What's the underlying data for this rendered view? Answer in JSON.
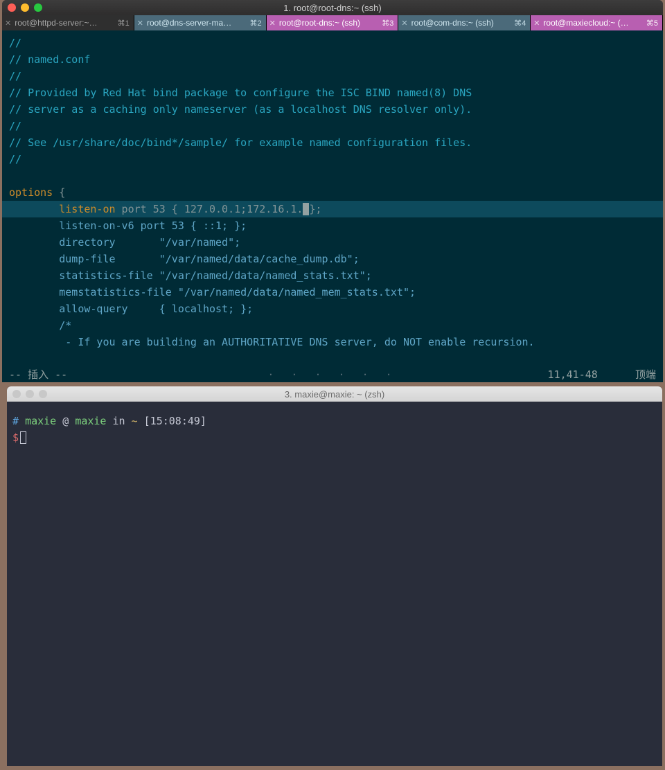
{
  "topWindow": {
    "title": "1. root@root-dns:~ (ssh)",
    "tabs": [
      {
        "label": "root@httpd-server:~…",
        "shortcut": "⌘1",
        "state": "normal"
      },
      {
        "label": "root@dns-server-ma…",
        "shortcut": "⌘2",
        "state": "dim"
      },
      {
        "label": "root@root-dns:~ (ssh)",
        "shortcut": "⌘3",
        "state": "active"
      },
      {
        "label": "root@com-dns:~ (ssh)",
        "shortcut": "⌘4",
        "state": "dim"
      },
      {
        "label": "root@maxiecloud:~ (…",
        "shortcut": "⌘5",
        "state": "active"
      }
    ],
    "editor": {
      "comments": [
        "//",
        "// named.conf",
        "//",
        "// Provided by Red Hat bind package to configure the ISC BIND named(8) DNS",
        "// server as a caching only nameserver (as a localhost DNS resolver only).",
        "//",
        "// See /usr/share/doc/bind*/sample/ for example named configuration files.",
        "//"
      ],
      "options_kw": "options",
      "brace_open": " {",
      "listen_on": {
        "key": "listen-on",
        "rest": " port 53 { 127.0.0.1;172.16.1.",
        "tail": "};"
      },
      "body": [
        "        listen-on-v6 port 53 { ::1; };",
        "        directory       \"/var/named\";",
        "        dump-file       \"/var/named/data/cache_dump.db\";",
        "        statistics-file \"/var/named/data/named_stats.txt\";",
        "        memstatistics-file \"/var/named/data/named_mem_stats.txt\";",
        "        allow-query     { localhost; };",
        "",
        "        /*",
        "         - If you are building an AUTHORITATIVE DNS server, do NOT enable recursion."
      ]
    },
    "status": {
      "left": "-- 插入 --",
      "dots": "· · · · · ·",
      "pos": "11,41-48",
      "right": "顶端"
    }
  },
  "bottomWindow": {
    "title": "3. maxie@maxie: ~ (zsh)",
    "prompt": {
      "hash": "#",
      "user": "maxie",
      "at": "@",
      "host": "maxie",
      "in": "in",
      "path": "~",
      "time": "[15:08:49]",
      "dollar": "$"
    }
  }
}
